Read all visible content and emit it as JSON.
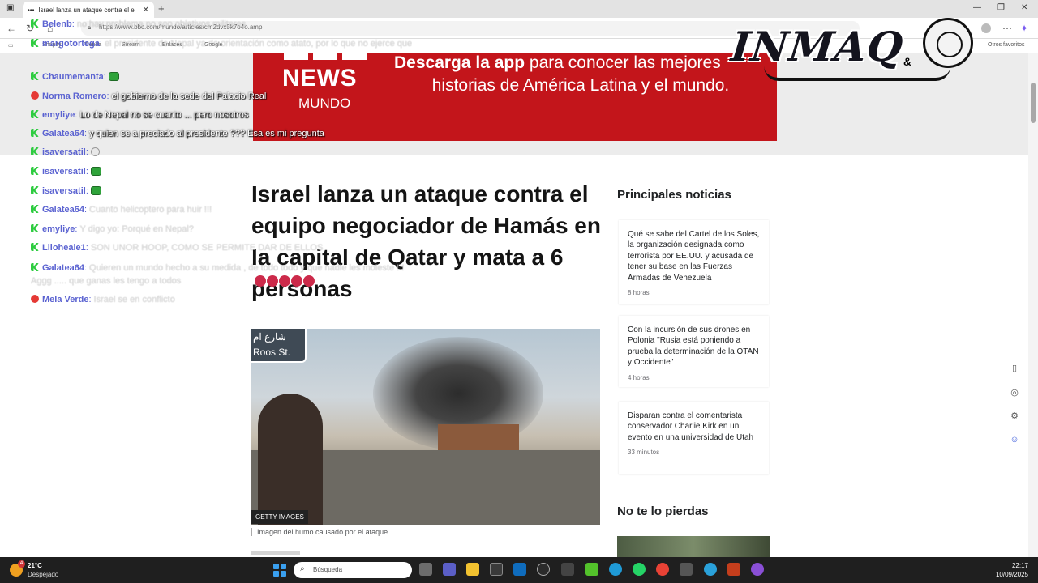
{
  "browser": {
    "tab_title": "Israel lanza un ataque contra el e",
    "url": "https://www.bbc.com/mundo/articles/cm2dvx5k7o4o.amp",
    "favorites": [
      "Shopify",
      "Tienda",
      "Stream",
      "Enlaces",
      "Google"
    ],
    "other_favorites": "Otros favoritos"
  },
  "banner": {
    "bbc_letters": [
      "",
      "",
      ""
    ],
    "news": "NEWS",
    "mundo": "MUNDO",
    "line1_bold": "Descarga la app",
    "line1_rest": " para conocer las mejores",
    "line2": "historias de América Latina y el mundo."
  },
  "article": {
    "headline": "Israel lanza un ataque contra el equipo negociador de Hamás en la capital de Qatar y mata a 6 personas",
    "image_credit": "GETTY IMAGES",
    "image_caption": "Imagen del humo causado por el ataque.",
    "sign_arabic": "شارع ام",
    "sign_english": "Roos St."
  },
  "sidebar": {
    "title": "Principales noticias",
    "stories": [
      {
        "text": "Qué se sabe del Cartel de los Soles, la organización designada como terrorista por EE.UU. y acusada de tener su base en las Fuerzas Armadas de Venezuela",
        "time": "8 horas"
      },
      {
        "text": "Con la incursión de sus drones en Polonia \"Rusia está poniendo a prueba la determinación de la OTAN y Occidente\"",
        "time": "4 horas"
      },
      {
        "text": "Disparan contra el comentarista conservador Charlie Kirk en un evento en una universidad de Utah",
        "time": "33 minutos"
      }
    ],
    "title2": "No te lo pierdas"
  },
  "chat": [
    {
      "badge": "k",
      "user": "Belenb",
      "msg": "no hay problema no son objetivos militares",
      "faint": true
    },
    {
      "badge": "k",
      "user": "margotortega",
      "msg": "el presidente de Nepal ya de orientación como atato, por lo que no ejerce que sean tan en alma de queso",
      "faint": true
    },
    {
      "badge": "k",
      "user": "Chaumemanta",
      "msg": "",
      "emote": "green"
    },
    {
      "badge": "yt",
      "user": "Norma Romero",
      "msg": "el gobierno de la sede del Palacio Real",
      "faint": false
    },
    {
      "badge": "k",
      "user": "emyliye",
      "msg": "Lo de Nepal no se cuanto ... pero nosotros",
      "faint": false
    },
    {
      "badge": "k",
      "user": "Galatea64",
      "msg": "y quien se a preciado al presidente ??? Esa es mi pregunta",
      "faint": false
    },
    {
      "badge": "k",
      "user": "isaversatil",
      "msg": "",
      "emote": "skull"
    },
    {
      "badge": "k",
      "user": "isaversatil",
      "msg": "",
      "emote": "green"
    },
    {
      "badge": "k",
      "user": "isaversatil",
      "msg": "",
      "emote": "green"
    },
    {
      "badge": "k",
      "user": "Galatea64",
      "msg": "Cuanto helicoptero para huir !!!",
      "faint": true
    },
    {
      "badge": "k",
      "user": "emyliye",
      "msg": "Y digo yo: Porqué en Nepal?",
      "faint": true
    },
    {
      "badge": "k",
      "user": "Liloheale1",
      "msg": "SON UNOR HOOP, COMO SE PERMITE DAR DE ELLOS",
      "faint": true
    },
    {
      "badge": "k",
      "user": "Galatea64",
      "msg": "Quieren un mundo hecho a su medida , de todo todo y que nadie les moleste ! ! Aggg ..... que ganas les tengo a todos",
      "faint": true
    },
    {
      "badge": "yt",
      "user": "Mela Verde",
      "msg": "Israel se en conflicto",
      "faint": true
    }
  ],
  "logo": {
    "text": "INMAQ",
    "amp": "&"
  },
  "taskbar": {
    "weather_temp": "21°C",
    "weather_desc": "Despejado",
    "weather_badge": "4",
    "search_placeholder": "Búsqueda",
    "time": "22:17",
    "date": "10/09/2025"
  },
  "colors": {
    "banner_red": "#c3151b",
    "chat_user": "#5b63d1",
    "kick_green": "#2ecc40"
  }
}
